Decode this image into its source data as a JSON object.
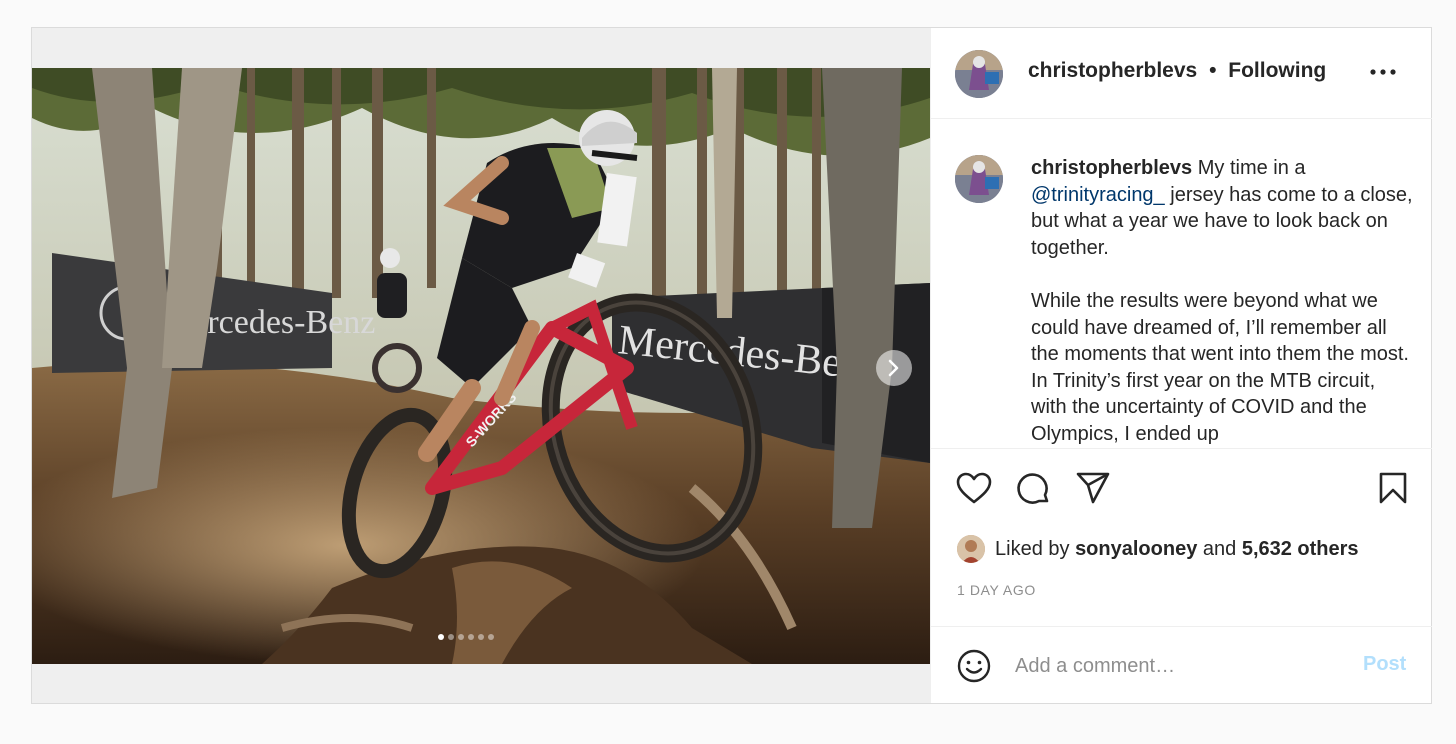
{
  "post": {
    "username": "christopherblevs",
    "separator": "•",
    "follow_status": "Following",
    "more_icon": "more-horizontal-icon"
  },
  "media": {
    "photo_description_icon": "mountain-bike-race-photo",
    "slide_index": 1,
    "slide_count": 6,
    "banner_text": "Mercedes-Benz",
    "bike_brand_text": "S-WORKS",
    "next_icon": "chevron-right-icon"
  },
  "caption": {
    "username": "christopherblevs",
    "line1_before": "My time in a",
    "mention": "@trinityracing_",
    "line1_after": "jersey has come to a close, but what a year we have to look back on together.",
    "paragraph2": "While the results were beyond what we could have dreamed of, I’ll remember all the moments that went into them the most. In Trinity’s first year on the MTB circuit, with the uncertainty of COVID and the Olympics, I ended up"
  },
  "actions": {
    "like_icon": "heart-icon",
    "comment_icon": "comment-icon",
    "share_icon": "share-icon",
    "save_icon": "bookmark-icon"
  },
  "likes": {
    "prefix": "Liked by",
    "liker": "sonyalooney",
    "conjunction": "and",
    "others": "5,632 others"
  },
  "timestamp": "1 DAY AGO",
  "comment_box": {
    "emoji_icon": "smiley-icon",
    "placeholder": "Add a comment…",
    "post_label": "Post"
  },
  "colors": {
    "mention": "#00376b",
    "post_button_disabled": "#b2dffc",
    "secondary_text": "#8e8e8e",
    "border": "#dbdbdb"
  }
}
